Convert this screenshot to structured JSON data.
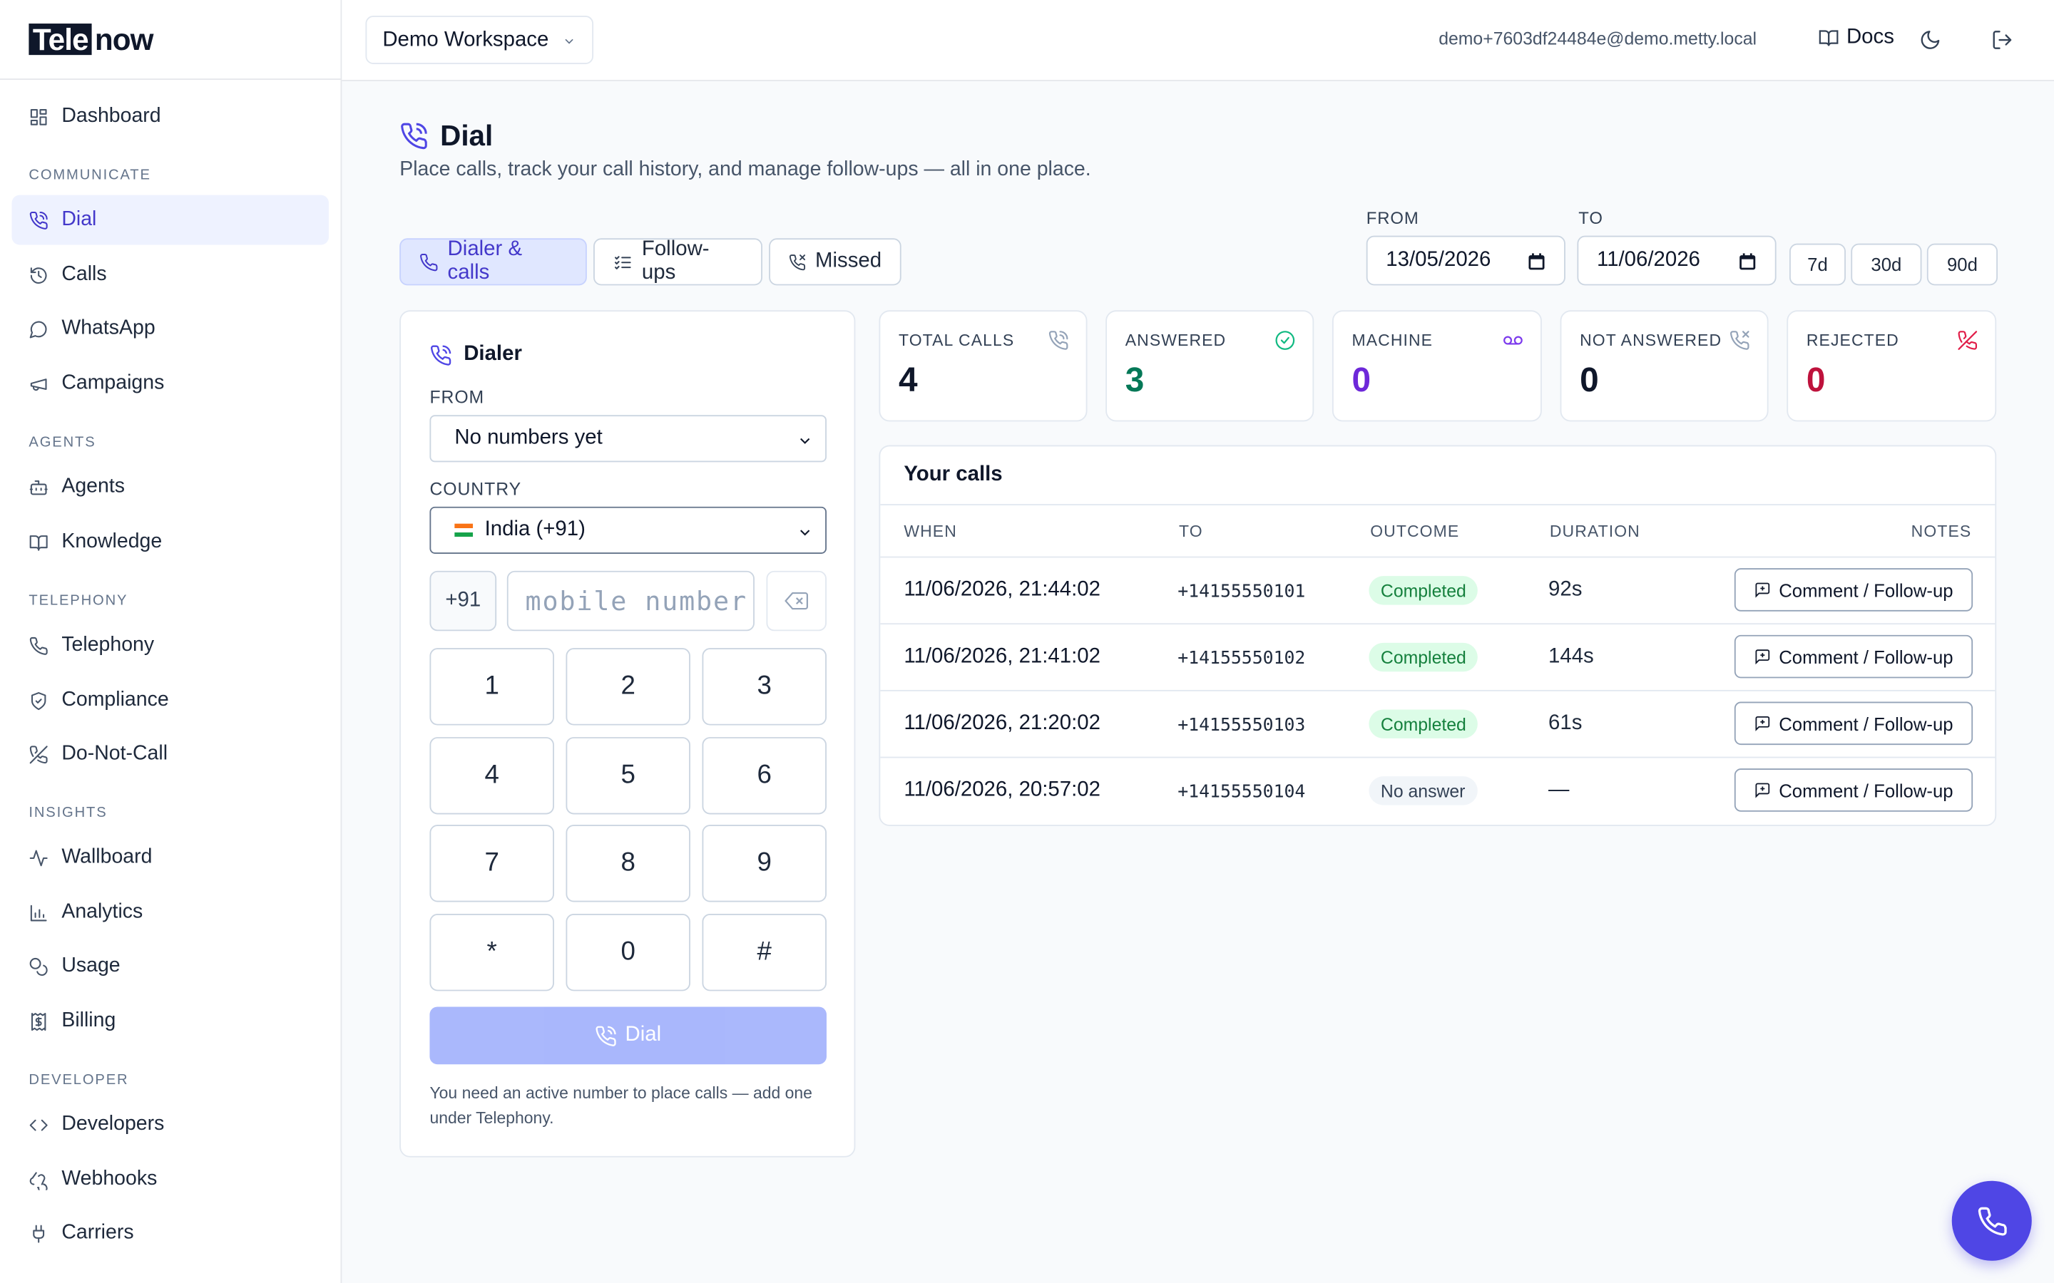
{
  "brand": {
    "part1": "Tele",
    "part2": "now"
  },
  "sidebar": {
    "dashboard": "Dashboard",
    "sections": {
      "communicate": "COMMUNICATE",
      "agents": "AGENTS",
      "telephony": "TELEPHONY",
      "insights": "INSIGHTS",
      "developer": "DEVELOPER"
    },
    "items": {
      "dial": "Dial",
      "calls": "Calls",
      "whatsapp": "WhatsApp",
      "campaigns": "Campaigns",
      "agents": "Agents",
      "knowledge": "Knowledge",
      "telephony": "Telephony",
      "compliance": "Compliance",
      "dnc": "Do-Not-Call",
      "wallboard": "Wallboard",
      "analytics": "Analytics",
      "usage": "Usage",
      "billing": "Billing",
      "developers": "Developers",
      "webhooks": "Webhooks",
      "carriers": "Carriers"
    }
  },
  "header": {
    "workspace": "Demo Workspace",
    "email": "demo+7603df24484e@demo.metty.local",
    "docs": "Docs"
  },
  "page": {
    "title": "Dial",
    "subtitle": "Place calls, track your call history, and manage follow-ups — all in one place."
  },
  "tabs": {
    "dialer": "Dialer & calls",
    "followups": "Follow-ups",
    "missed": "Missed"
  },
  "filters": {
    "from_label": "FROM",
    "to_label": "TO",
    "from_value": "13/05/2026",
    "to_value": "11/06/2026",
    "ranges": [
      "7d",
      "30d",
      "90d"
    ]
  },
  "dialer": {
    "title": "Dialer",
    "from_label": "FROM",
    "from_value": "No numbers yet",
    "country_label": "COUNTRY",
    "country_value": "India (+91)",
    "prefix": "+91",
    "placeholder": "mobile number",
    "keys": [
      "1",
      "2",
      "3",
      "4",
      "5",
      "6",
      "7",
      "8",
      "9",
      "*",
      "0",
      "#"
    ],
    "dial_label": "Dial",
    "note": "You need an active number to place calls — add one under Telephony."
  },
  "stats": {
    "total": {
      "label": "TOTAL CALLS",
      "value": "4",
      "color": "#0f172a"
    },
    "answered": {
      "label": "ANSWERED",
      "value": "3",
      "color": "#047857"
    },
    "machine": {
      "label": "MACHINE",
      "value": "0",
      "color": "#6d28d9"
    },
    "not_answered": {
      "label": "NOT ANSWERED",
      "value": "0",
      "color": "#0f172a"
    },
    "rejected": {
      "label": "REJECTED",
      "value": "0",
      "color": "#be123c"
    }
  },
  "calls": {
    "title": "Your calls",
    "headers": {
      "when": "WHEN",
      "to": "TO",
      "outcome": "OUTCOME",
      "duration": "DURATION",
      "notes": "NOTES"
    },
    "action_label": "Comment / Follow-up",
    "rows": [
      {
        "when": "11/06/2026, 21:44:02",
        "to": "+14155550101",
        "outcome": "Completed",
        "duration": "92s"
      },
      {
        "when": "11/06/2026, 21:41:02",
        "to": "+14155550102",
        "outcome": "Completed",
        "duration": "144s"
      },
      {
        "when": "11/06/2026, 21:20:02",
        "to": "+14155550103",
        "outcome": "Completed",
        "duration": "61s"
      },
      {
        "when": "11/06/2026, 20:57:02",
        "to": "+14155550104",
        "outcome": "No answer",
        "duration": "—"
      }
    ]
  },
  "colors": {
    "accent": "#4f46e5",
    "accent_soft": "#e0e7ff",
    "success": "#15803d",
    "danger": "#be123c"
  },
  "icons": {
    "phone": "phone-icon",
    "history": "history-icon",
    "message": "message-circle-icon",
    "megaphone": "megaphone-icon",
    "bot": "bot-icon",
    "book": "book-icon",
    "shield": "shield-icon",
    "phone_off": "phone-off-icon",
    "activity": "activity-icon",
    "chart": "bar-chart-icon",
    "coins": "coins-icon",
    "receipt": "receipt-icon",
    "code": "code-icon",
    "webhook": "webhook-icon",
    "plug": "plug-icon"
  }
}
